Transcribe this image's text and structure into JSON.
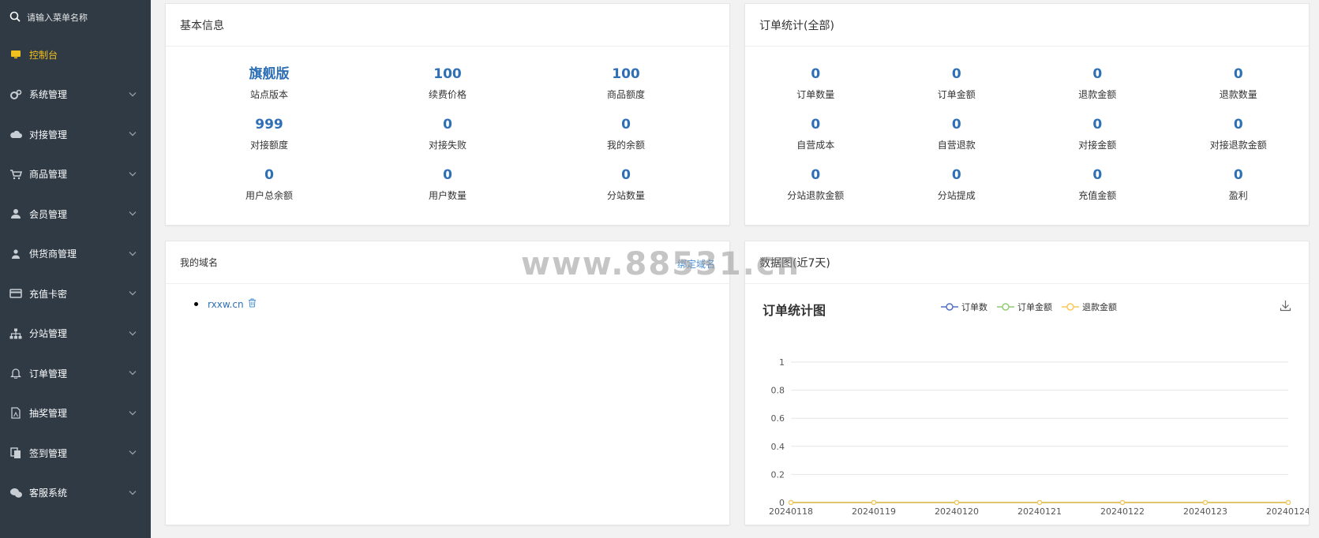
{
  "sidebar": {
    "search_placeholder": "请输入菜单名称",
    "items": [
      {
        "label": "控制台",
        "icon": "monitor-icon",
        "active": true
      },
      {
        "label": "系统管理",
        "icon": "gears-icon"
      },
      {
        "label": "对接管理",
        "icon": "cloud-icon"
      },
      {
        "label": "商品管理",
        "icon": "cart-icon"
      },
      {
        "label": "会员管理",
        "icon": "user-icon"
      },
      {
        "label": "供货商管理",
        "icon": "users-icon"
      },
      {
        "label": "充值卡密",
        "icon": "card-icon"
      },
      {
        "label": "分站管理",
        "icon": "sitemap-icon"
      },
      {
        "label": "订单管理",
        "icon": "bell-icon"
      },
      {
        "label": "抽奖管理",
        "icon": "file-icon"
      },
      {
        "label": "签到管理",
        "icon": "copy-icon"
      },
      {
        "label": "客服系统",
        "icon": "chat-icon"
      }
    ]
  },
  "basic": {
    "title": "基本信息",
    "stats": [
      {
        "value": "旗舰版",
        "label": "站点版本"
      },
      {
        "value": "100",
        "label": "续费价格"
      },
      {
        "value": "100",
        "label": "商品额度"
      },
      {
        "value": "999",
        "label": "对接额度"
      },
      {
        "value": "0",
        "label": "对接失败"
      },
      {
        "value": "0",
        "label": "我的余额"
      },
      {
        "value": "0",
        "label": "用户总余额"
      },
      {
        "value": "0",
        "label": "用户数量"
      },
      {
        "value": "0",
        "label": "分站数量"
      }
    ]
  },
  "orders": {
    "title": "订单统计(全部)",
    "stats": [
      {
        "value": "0",
        "label": "订单数量"
      },
      {
        "value": "0",
        "label": "订单金额"
      },
      {
        "value": "0",
        "label": "退款金额"
      },
      {
        "value": "0",
        "label": "退款数量"
      },
      {
        "value": "0",
        "label": "自营成本"
      },
      {
        "value": "0",
        "label": "自营退款"
      },
      {
        "value": "0",
        "label": "对接金额"
      },
      {
        "value": "0",
        "label": "对接退款金额"
      },
      {
        "value": "0",
        "label": "分站退款金额"
      },
      {
        "value": "0",
        "label": "分站提成"
      },
      {
        "value": "0",
        "label": "充值金额"
      },
      {
        "value": "0",
        "label": "盈利"
      }
    ]
  },
  "domain": {
    "title": "我的域名",
    "bind_label": "绑定域名",
    "items": [
      "rxxw.cn"
    ]
  },
  "chart_panel": {
    "title": "数据图(近7天)"
  },
  "watermark": "www.88531.cn",
  "chart_data": {
    "type": "line",
    "title": "订单统计图",
    "x": [
      "20240118",
      "20240119",
      "20240120",
      "20240121",
      "20240122",
      "20240123",
      "20240124"
    ],
    "series": [
      {
        "name": "订单数",
        "values": [
          0,
          0,
          0,
          0,
          0,
          0,
          0
        ],
        "color": "#5470c6"
      },
      {
        "name": "订单金额",
        "values": [
          0,
          0,
          0,
          0,
          0,
          0,
          0
        ],
        "color": "#91cc75"
      },
      {
        "name": "退款金额",
        "values": [
          0,
          0,
          0,
          0,
          0,
          0,
          0
        ],
        "color": "#fac858"
      }
    ],
    "ylim": [
      0,
      1
    ],
    "yticks": [
      "0",
      "0.2",
      "0.4",
      "0.6",
      "0.8",
      "1"
    ],
    "grid": true,
    "legend": "top"
  }
}
